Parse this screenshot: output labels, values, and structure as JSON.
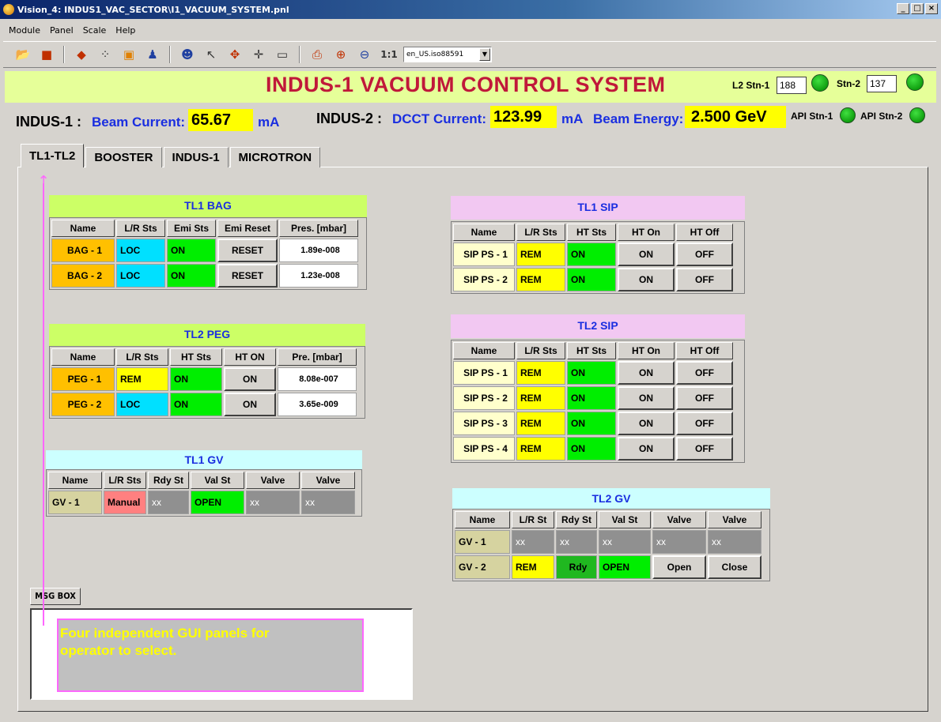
{
  "window": {
    "title": "Vision_4: INDUS1_VAC_SECTOR\\I1_VACUUM_SYSTEM.pnl",
    "minimize": "_",
    "maximize": "□",
    "close": "×"
  },
  "menu": [
    "Module",
    "Panel",
    "Scale",
    "Help"
  ],
  "toolbar": {
    "scale_label": "1:1",
    "locale": "en_US.iso88591",
    "locale_arrow": "▼"
  },
  "header": {
    "title": "INDUS-1 VACUUM CONTROL SYSTEM",
    "l2_stn1_label": "L2 Stn-1",
    "l2_stn1_value": "188",
    "stn2_label": "Stn-2",
    "stn2_value": "137",
    "api_stn1": "API Stn-1",
    "api_stn2": "API Stn-2"
  },
  "info": {
    "indus1_label": "INDUS-1 :",
    "beam_current_label": "Beam Current:",
    "beam_current_value": "65.67",
    "beam_current_unit": "mA",
    "indus2_label": "INDUS-2 :",
    "dcct_label": "DCCT Current:",
    "dcct_value": "123.99",
    "dcct_unit": "mA",
    "energy_label": "Beam Energy:",
    "energy_value": "2.500  GeV"
  },
  "tabs": [
    "TL1-TL2",
    "BOOSTER",
    "INDUS-1",
    "MICROTRON"
  ],
  "tl1_bag": {
    "title": "TL1 BAG",
    "headers": [
      "Name",
      "L/R Sts",
      "Emi Sts",
      "Emi Reset",
      "Pres. [mbar]"
    ],
    "rows": [
      {
        "name": "BAG - 1",
        "lr": "LOC",
        "emi": "ON",
        "reset": "RESET",
        "pres": "1.89e-008"
      },
      {
        "name": "BAG - 2",
        "lr": "LOC",
        "emi": "ON",
        "reset": "RESET",
        "pres": "1.23e-008"
      }
    ]
  },
  "tl2_peg": {
    "title": "TL2  PEG",
    "headers": [
      "Name",
      "L/R Sts",
      "HT Sts",
      "HT  ON",
      "Pre. [mbar]"
    ],
    "rows": [
      {
        "name": "PEG - 1",
        "lr": "REM",
        "ht": "ON",
        "on": "ON",
        "pres": "8.08e-007"
      },
      {
        "name": "PEG - 2",
        "lr": "LOC",
        "ht": "ON",
        "on": "ON",
        "pres": "3.65e-009"
      }
    ]
  },
  "tl1_gv": {
    "title": "TL1  GV",
    "headers": [
      "Name",
      "L/R Sts",
      "Rdy St",
      "Val St",
      "Valve",
      "Valve"
    ],
    "rows": [
      {
        "name": "GV - 1",
        "lr": "Manual",
        "rdy": "xx",
        "val": "OPEN",
        "v1": "xx",
        "v2": "xx"
      }
    ]
  },
  "tl1_sip": {
    "title": "TL1  SIP",
    "headers": [
      "Name",
      "L/R Sts",
      "HT Sts",
      "HT On",
      "HT Off"
    ],
    "rows": [
      {
        "name": "SIP PS - 1",
        "lr": "REM",
        "ht": "ON",
        "on": "ON",
        "off": "OFF"
      },
      {
        "name": "SIP PS - 2",
        "lr": "REM",
        "ht": "ON",
        "on": "ON",
        "off": "OFF"
      }
    ]
  },
  "tl2_sip": {
    "title": "TL2  SIP",
    "headers": [
      "Name",
      "L/R Sts",
      "HT Sts",
      "HT On",
      "HT Off"
    ],
    "rows": [
      {
        "name": "SIP PS - 1",
        "lr": "REM",
        "ht": "ON",
        "on": "ON",
        "off": "OFF"
      },
      {
        "name": "SIP PS - 2",
        "lr": "REM",
        "ht": "ON",
        "on": "ON",
        "off": "OFF"
      },
      {
        "name": "SIP PS - 3",
        "lr": "REM",
        "ht": "ON",
        "on": "ON",
        "off": "OFF"
      },
      {
        "name": "SIP PS - 4",
        "lr": "REM",
        "ht": "ON",
        "on": "ON",
        "off": "OFF"
      }
    ]
  },
  "tl2_gv": {
    "title": "TL2  GV",
    "headers": [
      "Name",
      "L/R St",
      "Rdy St",
      "Val St",
      "Valve",
      "Valve"
    ],
    "rows": [
      {
        "name": "GV - 1",
        "lr": "xx",
        "rdy": "xx",
        "val": "xx",
        "v1": "xx",
        "v2": "xx"
      },
      {
        "name": "GV - 2",
        "lr": "REM",
        "rdy": "Rdy",
        "val": "OPEN",
        "v1": "Open",
        "v2": "Close"
      }
    ]
  },
  "msg_box": {
    "label": "MSG BOX",
    "annotation_line1": "Four independent GUI panels for",
    "annotation_line2": "operator to select.",
    "arrow": "↑"
  },
  "colors": {
    "title_red": "#c0183a",
    "label_blue": "#1a2ee0",
    "value_yellow": "#ffff00",
    "status_green": "#00ee00",
    "annotation_pink": "#ff66ff"
  }
}
